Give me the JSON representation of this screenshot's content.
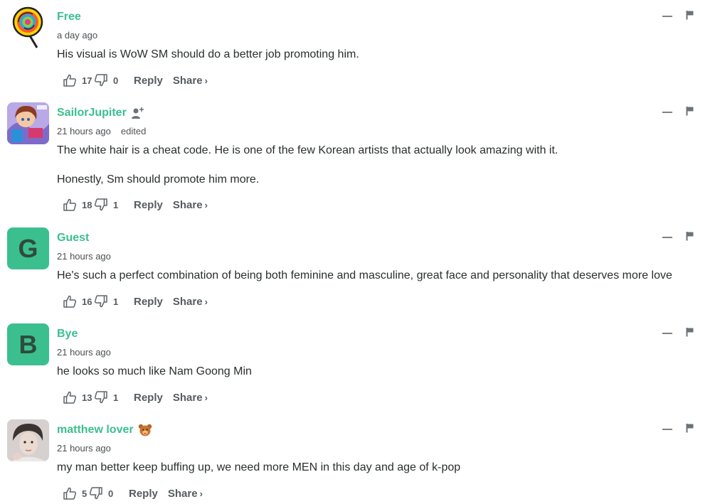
{
  "comments": [
    {
      "author": "Free",
      "time": "a day ago",
      "edited": "",
      "avatar": {
        "kind": "image",
        "icon": "lollipop-avatar-icon"
      },
      "badge": "",
      "paragraphs": [
        "His visual is WoW SM should do a better job promoting him."
      ],
      "upvotes": "17",
      "downvotes": "0",
      "reply_label": "Reply",
      "share_label": "Share"
    },
    {
      "author": "SailorJupiter",
      "time": "21 hours ago",
      "edited": "edited",
      "avatar": {
        "kind": "image",
        "icon": "anime-character-avatar-icon"
      },
      "badge": "follow-user-icon",
      "paragraphs": [
        "The white hair is a cheat code. He is one of the few Korean artists that actually look amazing with it.",
        "Honestly, Sm should promote him more."
      ],
      "upvotes": "18",
      "downvotes": "1",
      "reply_label": "Reply",
      "share_label": "Share"
    },
    {
      "author": "Guest",
      "time": "21 hours ago",
      "edited": "",
      "avatar": {
        "kind": "letter",
        "letter": "G",
        "color": "#3bbf8f"
      },
      "badge": "",
      "paragraphs": [
        "He's such a perfect combination of being both feminine and masculine, great face and personality that deserves more love"
      ],
      "upvotes": "16",
      "downvotes": "1",
      "reply_label": "Reply",
      "share_label": "Share"
    },
    {
      "author": "Bye",
      "time": "21 hours ago",
      "edited": "",
      "avatar": {
        "kind": "letter",
        "letter": "B",
        "color": "#3bbf8f"
      },
      "badge": "",
      "paragraphs": [
        "he looks so much like Nam Goong Min"
      ],
      "upvotes": "13",
      "downvotes": "1",
      "reply_label": "Reply",
      "share_label": "Share"
    },
    {
      "author": "matthew lover",
      "time": "21 hours ago",
      "edited": "",
      "avatar": {
        "kind": "image",
        "icon": "portrait-photo-avatar-icon"
      },
      "badge": "bear-emoji-badge-icon",
      "paragraphs": [
        "my man better keep buffing up, we need more MEN in this day and age of k-pop"
      ],
      "upvotes": "5",
      "downvotes": "0",
      "reply_label": "Reply",
      "share_label": "Share"
    }
  ],
  "colors": {
    "accent": "#3bbf8f",
    "text": "#2a2e2e",
    "muted": "#555c60"
  }
}
